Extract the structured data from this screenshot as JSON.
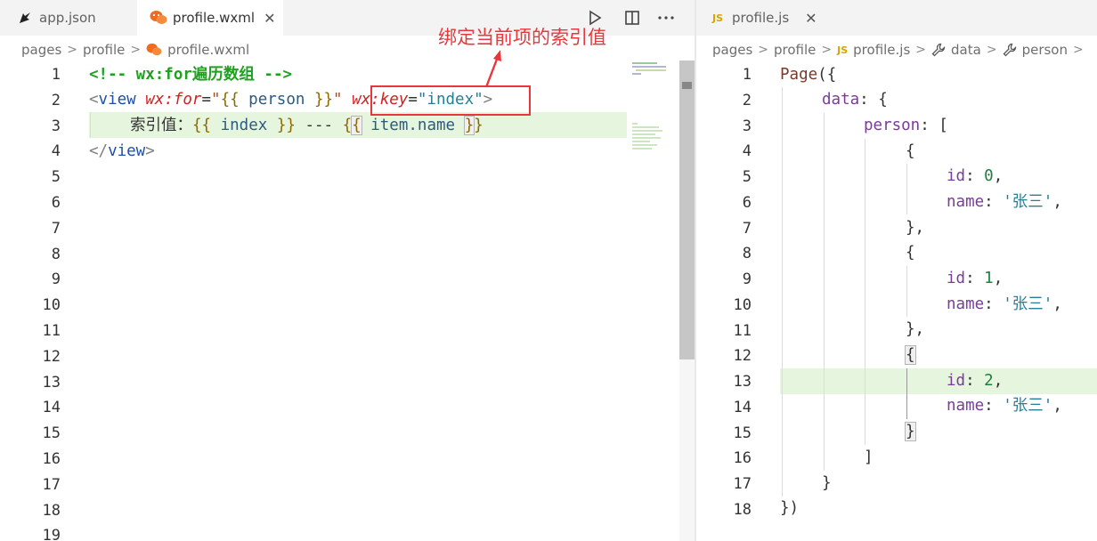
{
  "colors": {
    "annotation": "#e8363a",
    "line_highlight": "#e6f5dd",
    "tabbar_bg": "#f3f3f3"
  },
  "left": {
    "tabs": [
      {
        "label": "app.json",
        "icon": "pen-icon",
        "active": false
      },
      {
        "label": "profile.wxml",
        "icon": "wechat-icon",
        "active": true,
        "close": "✕"
      }
    ],
    "breadcrumb": [
      "pages",
      "profile",
      "profile.wxml"
    ],
    "line_numbers": [
      "1",
      "2",
      "3",
      "4",
      "5",
      "6",
      "7",
      "8",
      "9",
      "10",
      "11",
      "12",
      "13",
      "14",
      "15",
      "16",
      "17",
      "18",
      "19"
    ],
    "code": {
      "l1": "<!-- wx:for遍历数组 -->",
      "l2": {
        "lt": "<",
        "tag": "view",
        "attr1": "wx:for",
        "eq": "=",
        "q": "\"",
        "b1": "{{",
        "var": " person ",
        "b2": "}}",
        "attr2": "wx:key",
        "val2": "index",
        "gt": ">"
      },
      "l3": {
        "label": "索引值：",
        "b1": "{{",
        "v1": " index ",
        "b2": "}}",
        "dash": " --- ",
        "b3": "{",
        "b3b": "{",
        "v2": " item.",
        "v2b": "name ",
        "b4": "}",
        "b4b": "}"
      },
      "l4": {
        "lt": "</",
        "tag": "view",
        "gt": ">"
      }
    },
    "annotation": "绑定当前项的索引值"
  },
  "right": {
    "tabs": [
      {
        "label": "profile.js",
        "icon": "js-icon",
        "badge": "JS",
        "active": false,
        "close": "✕"
      }
    ],
    "breadcrumb": [
      "pages",
      "profile",
      "profile.js",
      "data",
      "person"
    ],
    "breadcrumb_js_badge": "JS",
    "line_numbers": [
      "1",
      "2",
      "3",
      "4",
      "5",
      "6",
      "7",
      "8",
      "9",
      "10",
      "11",
      "12",
      "13",
      "14",
      "15",
      "16",
      "17",
      "18"
    ],
    "code": {
      "l1_fn": "Page",
      "l1_rest": "({",
      "l2_key": "data",
      "l2_rest": ": {",
      "l3_key": "person",
      "l3_rest": ": [",
      "open": "{",
      "close_comma": "},",
      "close": "}",
      "id_key": "id",
      "colon": ": ",
      "comma": ",",
      "name_key": "name",
      "name_val": "'张三'",
      "ids": [
        "0",
        "1",
        "2"
      ],
      "l16": "]",
      "l17": "}",
      "l18": "})"
    }
  }
}
